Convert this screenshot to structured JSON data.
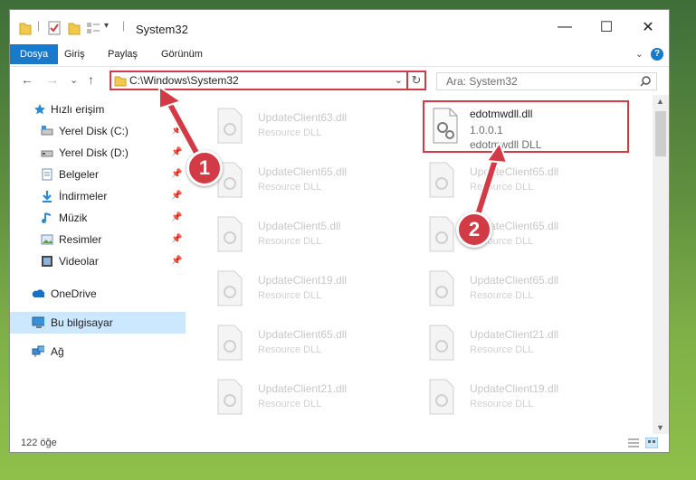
{
  "window": {
    "title": "System32",
    "controls": {
      "minimize": "—",
      "maximize": "☐",
      "close": "✕"
    }
  },
  "ribbon": {
    "tabs": [
      "Dosya",
      "Giriş",
      "Paylaş",
      "Görünüm"
    ],
    "help": "?"
  },
  "navbar": {
    "back": "←",
    "forward": "→",
    "recent": "⌄",
    "up": "↑",
    "address": "C:\\Windows\\System32",
    "refresh": "↻",
    "search_placeholder": "Ara: System32"
  },
  "sidebar": {
    "items": [
      {
        "label": "Hızlı erişim",
        "icon": "star-icon",
        "pinned": false
      },
      {
        "label": "Yerel Disk (C:)",
        "icon": "drive-icon",
        "pinned": true
      },
      {
        "label": "Yerel Disk (D:)",
        "icon": "drive-icon",
        "pinned": true
      },
      {
        "label": "Belgeler",
        "icon": "documents-icon",
        "pinned": true
      },
      {
        "label": "İndirmeler",
        "icon": "download-icon",
        "pinned": true
      },
      {
        "label": "Müzik",
        "icon": "music-icon",
        "pinned": true
      },
      {
        "label": "Resimler",
        "icon": "pictures-icon",
        "pinned": true
      },
      {
        "label": "Videolar",
        "icon": "videos-icon",
        "pinned": true
      },
      {
        "label": "OneDrive",
        "icon": "cloud-icon",
        "pinned": false
      },
      {
        "label": "Bu bilgisayar",
        "icon": "computer-icon",
        "pinned": false,
        "selected": true
      },
      {
        "label": "Ağ",
        "icon": "network-icon",
        "pinned": false
      }
    ],
    "pin_glyph": "📌"
  },
  "files": {
    "left": [
      {
        "name": "UpdateClient63.dll",
        "desc": "Resource DLL"
      },
      {
        "name": "UpdateClient65.dll",
        "desc": "Resource DLL"
      },
      {
        "name": "UpdateClient5.dll",
        "desc": "Resource DLL"
      },
      {
        "name": "UpdateClient19.dll",
        "desc": "Resource DLL"
      },
      {
        "name": "UpdateClient65.dll",
        "desc": "Resource DLL"
      },
      {
        "name": "UpdateClient21.dll",
        "desc": "Resource DLL"
      }
    ],
    "selected": {
      "name": "edotmwdll.dll",
      "version": "1.0.0.1",
      "desc": "edotmwdll DLL"
    },
    "right": [
      {
        "name": "UpdateClient65.dll",
        "desc": "Resource DLL"
      },
      {
        "name": "UpdateClient65.dll",
        "desc": "Resource DLL"
      },
      {
        "name": "UpdateClient65.dll",
        "desc": "Resource DLL"
      },
      {
        "name": "UpdateClient21.dll",
        "desc": "Resource DLL"
      },
      {
        "name": "UpdateClient19.dll",
        "desc": "Resource DLL"
      }
    ]
  },
  "status": {
    "count_text": "122 öğe"
  },
  "markers": [
    "1",
    "2"
  ],
  "colors": {
    "accent": "#1979ca",
    "highlight": "#d23b45",
    "selection": "#cce8ff"
  }
}
